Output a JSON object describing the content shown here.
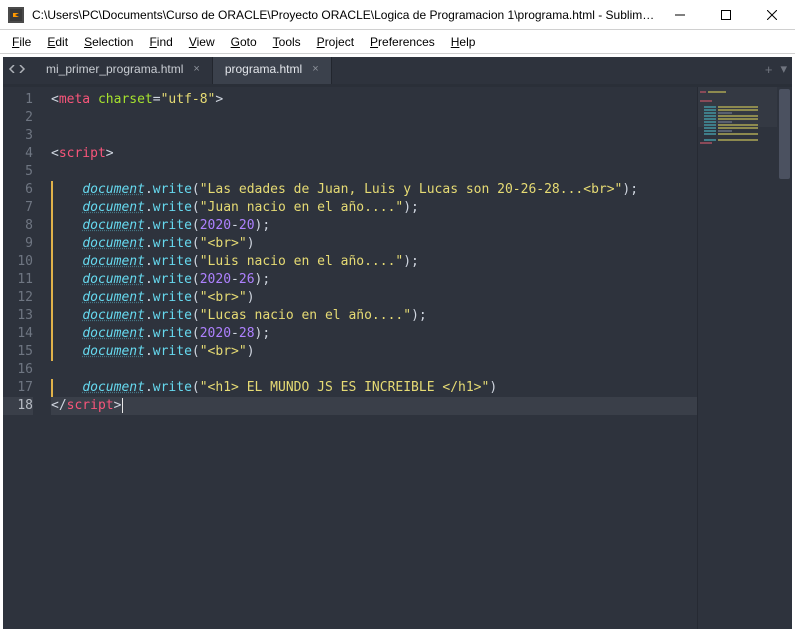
{
  "window": {
    "title": "C:\\Users\\PC\\Documents\\Curso de ORACLE\\Proyecto ORACLE\\Logica de Programacion 1\\programa.html - Sublime T..."
  },
  "menu": {
    "file": "File",
    "edit": "Edit",
    "selection": "Selection",
    "find": "Find",
    "view": "View",
    "goto": "Goto",
    "tools": "Tools",
    "project": "Project",
    "preferences": "Preferences",
    "help": "Help"
  },
  "tabs": {
    "inactive": {
      "name": "mi_primer_programa.html"
    },
    "active": {
      "name": "programa.html"
    }
  },
  "code": {
    "active_line": 18,
    "lines": [
      {
        "n": 1,
        "marked": false,
        "type": "meta"
      },
      {
        "n": 2,
        "marked": false,
        "type": "blank"
      },
      {
        "n": 3,
        "marked": false,
        "type": "blank"
      },
      {
        "n": 4,
        "marked": false,
        "type": "open_script"
      },
      {
        "n": 5,
        "marked": false,
        "type": "blank"
      },
      {
        "n": 6,
        "marked": true,
        "type": "write",
        "str": "\"Las edades de Juan, Luis y Lucas son 20-26-28...<br>\"",
        "semi": true
      },
      {
        "n": 7,
        "marked": true,
        "type": "write",
        "str": "\"Juan nacio en el año....\"",
        "semi": true
      },
      {
        "n": 8,
        "marked": true,
        "type": "writenum",
        "a": "2020",
        "b": "20",
        "semi": true
      },
      {
        "n": 9,
        "marked": true,
        "type": "write",
        "str": "\"<br>\"",
        "semi": false
      },
      {
        "n": 10,
        "marked": true,
        "type": "write",
        "str": "\"Luis nacio en el año....\"",
        "semi": true
      },
      {
        "n": 11,
        "marked": true,
        "type": "writenum",
        "a": "2020",
        "b": "26",
        "semi": true
      },
      {
        "n": 12,
        "marked": true,
        "type": "write",
        "str": "\"<br>\"",
        "semi": false
      },
      {
        "n": 13,
        "marked": true,
        "type": "write",
        "str": "\"Lucas nacio en el año....\"",
        "semi": true
      },
      {
        "n": 14,
        "marked": true,
        "type": "writenum",
        "a": "2020",
        "b": "28",
        "semi": true
      },
      {
        "n": 15,
        "marked": true,
        "type": "write",
        "str": "\"<br>\"",
        "semi": false
      },
      {
        "n": 16,
        "marked": false,
        "type": "blank"
      },
      {
        "n": 17,
        "marked": true,
        "type": "write",
        "str": "\"<h1> EL MUNDO JS ES INCREIBLE </h1>\"",
        "semi": false
      },
      {
        "n": 18,
        "marked": false,
        "type": "close_script"
      }
    ]
  }
}
